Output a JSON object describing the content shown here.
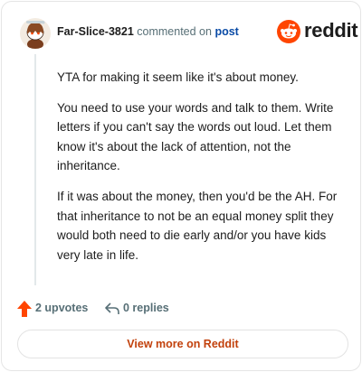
{
  "header": {
    "username": "Far-Slice-3821",
    "action_text": "commented on",
    "post_link": "post",
    "brand": "reddit",
    "avatar_icon": "reddit-snoo-avatar-icon",
    "brand_icon": "reddit-logo-icon"
  },
  "comment": {
    "paragraphs": [
      "YTA for making it seem like it's about money.",
      "You need to use your words and talk to them. Write letters if you can't say the words out loud. Let them know it's about the lack of attention, not the inheritance.",
      "If it was about the money, then you'd be the AH. For that inheritance to not be an equal money split they would both need to die early and/or you have kids very late in life."
    ]
  },
  "actions": {
    "upvotes": "2 upvotes",
    "replies": "0 replies",
    "upvote_icon": "upvote-arrow-icon",
    "reply_icon": "reply-arrow-icon"
  },
  "footer": {
    "button_label": "View more on Reddit"
  },
  "colors": {
    "accent_orange": "#ff4500",
    "link_blue": "#0a4ba6",
    "button_text": "#c2410c",
    "muted_text": "#576f76"
  }
}
